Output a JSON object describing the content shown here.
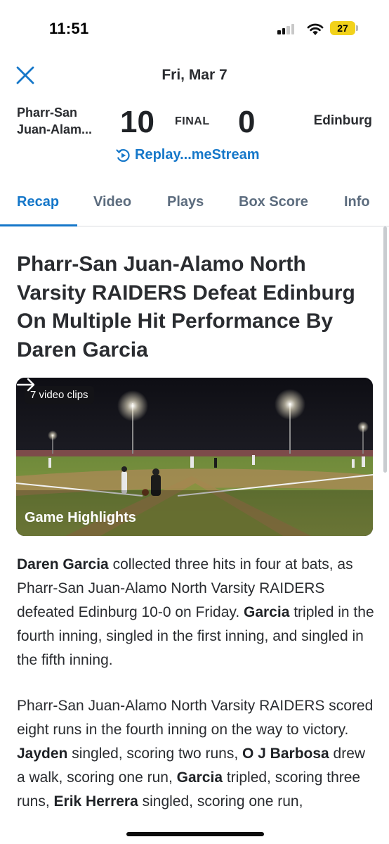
{
  "status_bar": {
    "time": "11:51",
    "battery_level": "27",
    "battery_color": "#f2d21b"
  },
  "header": {
    "close_icon": "close-icon",
    "date": "Fri, Mar 7",
    "home_team_line1": "Pharr-San",
    "home_team_line2": "Juan-Alam...",
    "home_score": "10",
    "status": "FINAL",
    "away_score": "0",
    "away_team": "Edinburg",
    "replay_label": "Replay...meStream",
    "replay_icon": "replay-icon"
  },
  "tabs": [
    {
      "label": "Recap",
      "active": true
    },
    {
      "label": "Video",
      "active": false
    },
    {
      "label": "Plays",
      "active": false
    },
    {
      "label": "Box Score",
      "active": false
    },
    {
      "label": "Info",
      "active": false
    }
  ],
  "article": {
    "headline": "Pharr-San Juan-Alamo North Varsity RAIDERS Defeat Edinburg On Multiple Hit Performance By Daren Garcia",
    "video": {
      "clips_badge": "7 video clips",
      "title": "Game Highlights",
      "arrow_icon": "arrow-right-icon"
    },
    "p1": {
      "b1": "Daren Garcia",
      "t1": " collected three hits in four at bats, as Pharr-San Juan-Alamo North Varsity RAIDERS defeated Edinburg 10-0 on Friday. ",
      "b2": "Garcia",
      "t2": " tripled in the fourth inning, singled in the first inning, and singled in the fifth inning."
    },
    "p2": {
      "t1": "Pharr-San Juan-Alamo North Varsity RAIDERS scored eight runs in the fourth inning on the way to victory.  ",
      "b1": "Jayden",
      "t2": " singled, scoring two runs, ",
      "b2": "O J Barbosa",
      "t3": " drew a walk, scoring one run, ",
      "b3": "Garcia",
      "t4": " tripled, scoring three runs, ",
      "b4": "Erik Herrera",
      "t5": " singled, scoring one run,"
    }
  },
  "colors": {
    "accent": "#1577c9",
    "tab_inactive": "#5c6c7e",
    "text": "#2a2c30"
  }
}
